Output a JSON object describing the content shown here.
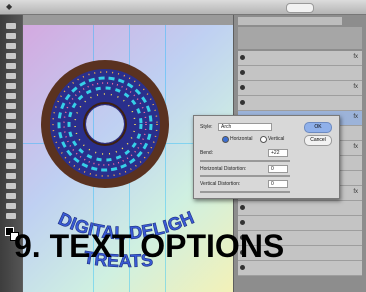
{
  "caption": "9. TEXT OPTIONS",
  "canvas_text_line1": "DIGITAL DELIGHT",
  "canvas_text_line2": "TREATS",
  "dialog": {
    "style_label": "Style:",
    "style_value": "Arch",
    "ok_label": "OK",
    "cancel_label": "Cancel",
    "horizontal_label": "Horizontal",
    "vertical_label": "Vertical",
    "bend_label": "Bend:",
    "bend_value": "+22",
    "hdist_label": "Horizontal Distortion:",
    "hdist_value": "0",
    "vdist_label": "Vertical Distortion:",
    "vdist_value": "0"
  },
  "colors": {
    "donut_dough": "#5a3220",
    "frosting": "#2a2f8c",
    "wave_cyan": "#36d0e8",
    "text_blue": "#3a5bd6"
  },
  "icons": [
    "apple-logo-icon",
    "eye-icon",
    "fx-icon"
  ]
}
